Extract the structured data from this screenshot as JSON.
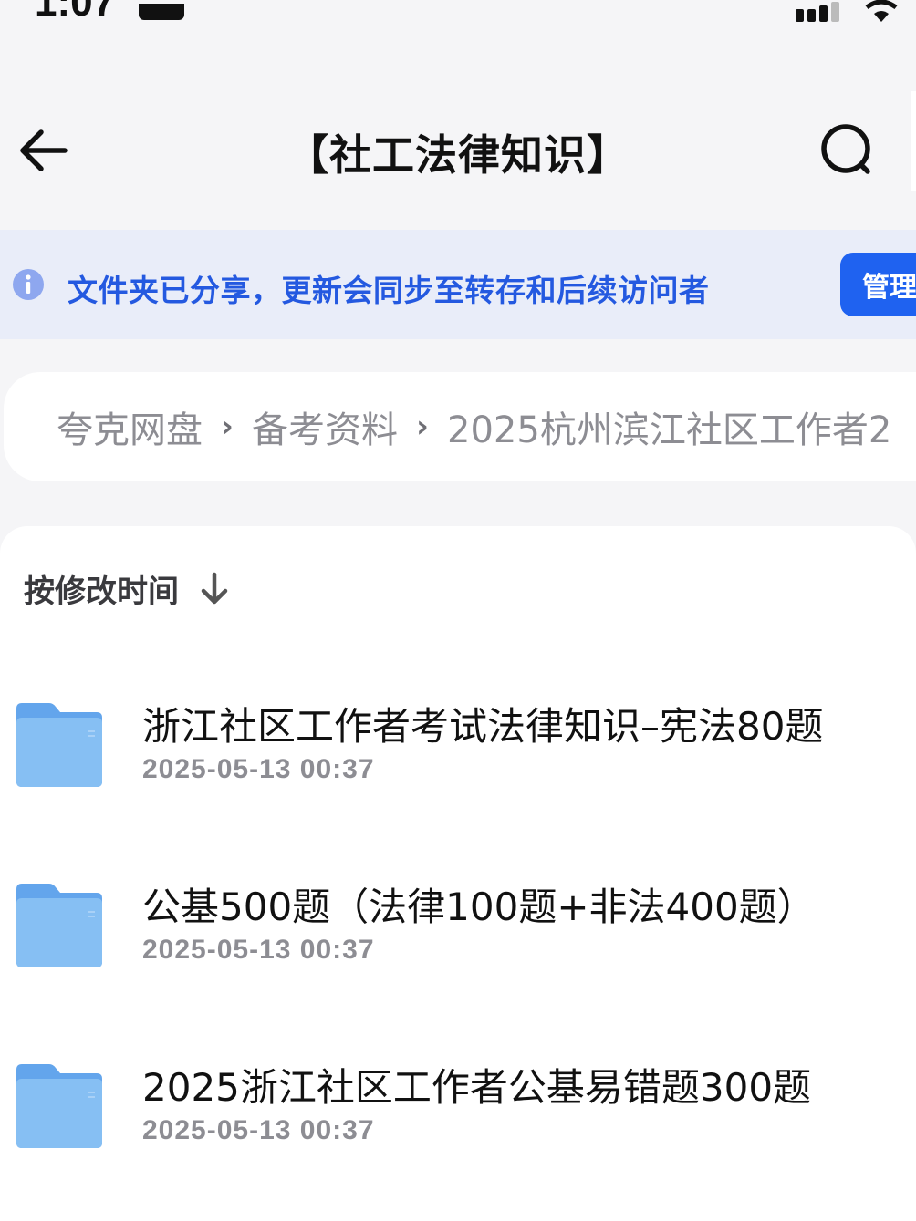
{
  "status_bar": {
    "time": "1:07"
  },
  "header": {
    "title": "【社工法律知识】",
    "back_icon": "arrow-left-icon",
    "search_icon": "search-icon"
  },
  "banner": {
    "text": "文件夹已分享，更新会同步至转存和后续访问者",
    "manage_label": "管理",
    "accent_color": "#1f62f0",
    "text_color": "#2459e0"
  },
  "breadcrumb": {
    "items": [
      "夸克网盘",
      "备考资料",
      "2025杭州滨江社区工作者2"
    ],
    "separator": "›"
  },
  "sort": {
    "label": "按修改时间",
    "direction_icon": "arrow-down-icon"
  },
  "files": [
    {
      "name": "浙江社区工作者考试法律知识–宪法80题",
      "modified": "2025-05-13 00:37",
      "type": "folder"
    },
    {
      "name": "公基500题（法律100题+非法400题）",
      "modified": "2025-05-13 00:37",
      "type": "folder"
    },
    {
      "name": "2025浙江社区工作者公基易错题300题",
      "modified": "2025-05-13 00:37",
      "type": "folder"
    }
  ]
}
